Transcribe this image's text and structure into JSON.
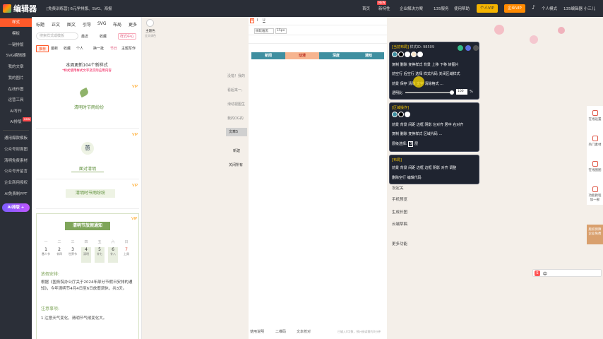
{
  "topbar": {
    "logo_text": "编辑器",
    "promo": "[免费训练营] 6元学排版、SVG、海报",
    "nav": [
      "首页",
      "新特性",
      "企业解决方案",
      "135服务",
      "使用帮助"
    ],
    "new_tag": "NEW",
    "vip_btn": "个人VIP",
    "enterprise_vip_btn": "企业VIP",
    "personal_mode": "个人模式",
    "user": "135编辑器 小三儿",
    "accent": "#ff5a2a"
  },
  "leftnav": {
    "items": [
      "样式",
      "模板",
      "一键排版",
      "SVG编辑器",
      "我的文章",
      "我的图片",
      "在线作图",
      "运营工具",
      "AI写作",
      "AI排版"
    ],
    "items2": [
      "通用爆款模板",
      "公众号封面图",
      "清明免费素材",
      "公众号开留言",
      "企业商用授权",
      "AI免费制PPT"
    ],
    "ai_btn": "AI排版 +",
    "new_badge": "new"
  },
  "matpanel": {
    "tabs": [
      "标题",
      "正文",
      "图文",
      "引导",
      "SVG",
      "布局",
      "更多"
    ],
    "search_placeholder": "搜索样式或模板",
    "filters": [
      "最近",
      "收藏",
      "样式中心"
    ],
    "avatar_label": "主题色",
    "avatar_sub": "全文调色",
    "chips": [
      "推荐",
      "最新",
      "收藏",
      "个人",
      "换一批",
      "节日",
      "主题写作"
    ],
    "notice": "本周更新104个新样式",
    "notice_sub": "*样式使用样式文字及实际应用内容",
    "vip_label": "VIP",
    "card1_title": "清明时节雨纷纷",
    "card2_char": "蕙",
    "card2_title": "面对清明",
    "card3_title": "清明时节雨纷纷",
    "holiday_title": "清明节放假通知",
    "weekdays": [
      "一",
      "二",
      "三",
      "四",
      "五",
      "六",
      "日"
    ],
    "days": [
      {
        "n": "1",
        "s": "愚人节"
      },
      {
        "n": "2",
        "s": "廿四"
      },
      {
        "n": "3",
        "s": "世界节"
      },
      {
        "n": "4",
        "s": "清明"
      },
      {
        "n": "5",
        "s": "廿七"
      },
      {
        "n": "6",
        "s": "廿八"
      },
      {
        "n": "7",
        "s": "上周"
      }
    ],
    "section1": "放假安排:",
    "para1": "根据《国务院办公厅关于2024年部分节假日安排的通知》，今年清明节4月4日至6日放假调休，共3天。",
    "section2": "注意事项:",
    "para2": "1.注意天气变化，清明节气候变化大。"
  },
  "leftcol": {
    "items": [
      "没错！我的",
      "看起来一,",
      "滑动视图生",
      "我的OG的",
      "文章5",
      "新建",
      "关闭所有"
    ]
  },
  "editor": {
    "toolbar_row2": [
      "微软雅黑",
      "15px"
    ],
    "navbar": [
      "新闻",
      "动漫",
      "深度",
      "通知"
    ],
    "side_btns": [
      "设定关",
      "手机预览",
      "生成长图",
      "云端草稿",
      "更多功能"
    ],
    "footer": [
      "使用说明",
      "二维码",
      "文本校对"
    ],
    "footer_hint": "已输入0字数，预计阅读需约0分钟"
  },
  "popup1": {
    "header": "[当前布局]",
    "id_label": "样式ID: 98509",
    "row1": [
      "复制",
      "删除",
      "变换样式",
      "背景",
      "上移",
      "下移",
      "转图片"
    ],
    "row2": [
      "前空行",
      "后空行",
      "选择",
      "样式代码",
      "关闭区域样式"
    ],
    "row3": [
      "前景",
      "保存",
      "清除",
      "文字",
      "清除格式",
      "..."
    ],
    "transparency_label": "透明比",
    "transparency": 100,
    "unit": "%"
  },
  "popup2": {
    "header": "[区域操作]",
    "row1": [
      "前景",
      "背景",
      "间距",
      "边框",
      "阴影",
      "左对齐",
      "居中",
      "右对齐"
    ],
    "row2": [
      "复制",
      "删除",
      "变换样式",
      "区域代码",
      "..."
    ],
    "layer_label": "层级选择",
    "layer_val": "3",
    "layer_unit": "层"
  },
  "popup3": {
    "header": "[布局]",
    "row1": [
      "前景",
      "背景",
      "间距",
      "边框",
      "边框",
      "阴影",
      "对齐",
      "调整"
    ],
    "row2": [
      "删除空行",
      "编辑代码"
    ]
  },
  "rightbar": {
    "items": [
      "在线设置",
      "热门素材",
      "在线图图",
      "功能教程 加一部"
    ],
    "brand": "版权保障 企业免费"
  },
  "ime": {
    "label": "中"
  }
}
